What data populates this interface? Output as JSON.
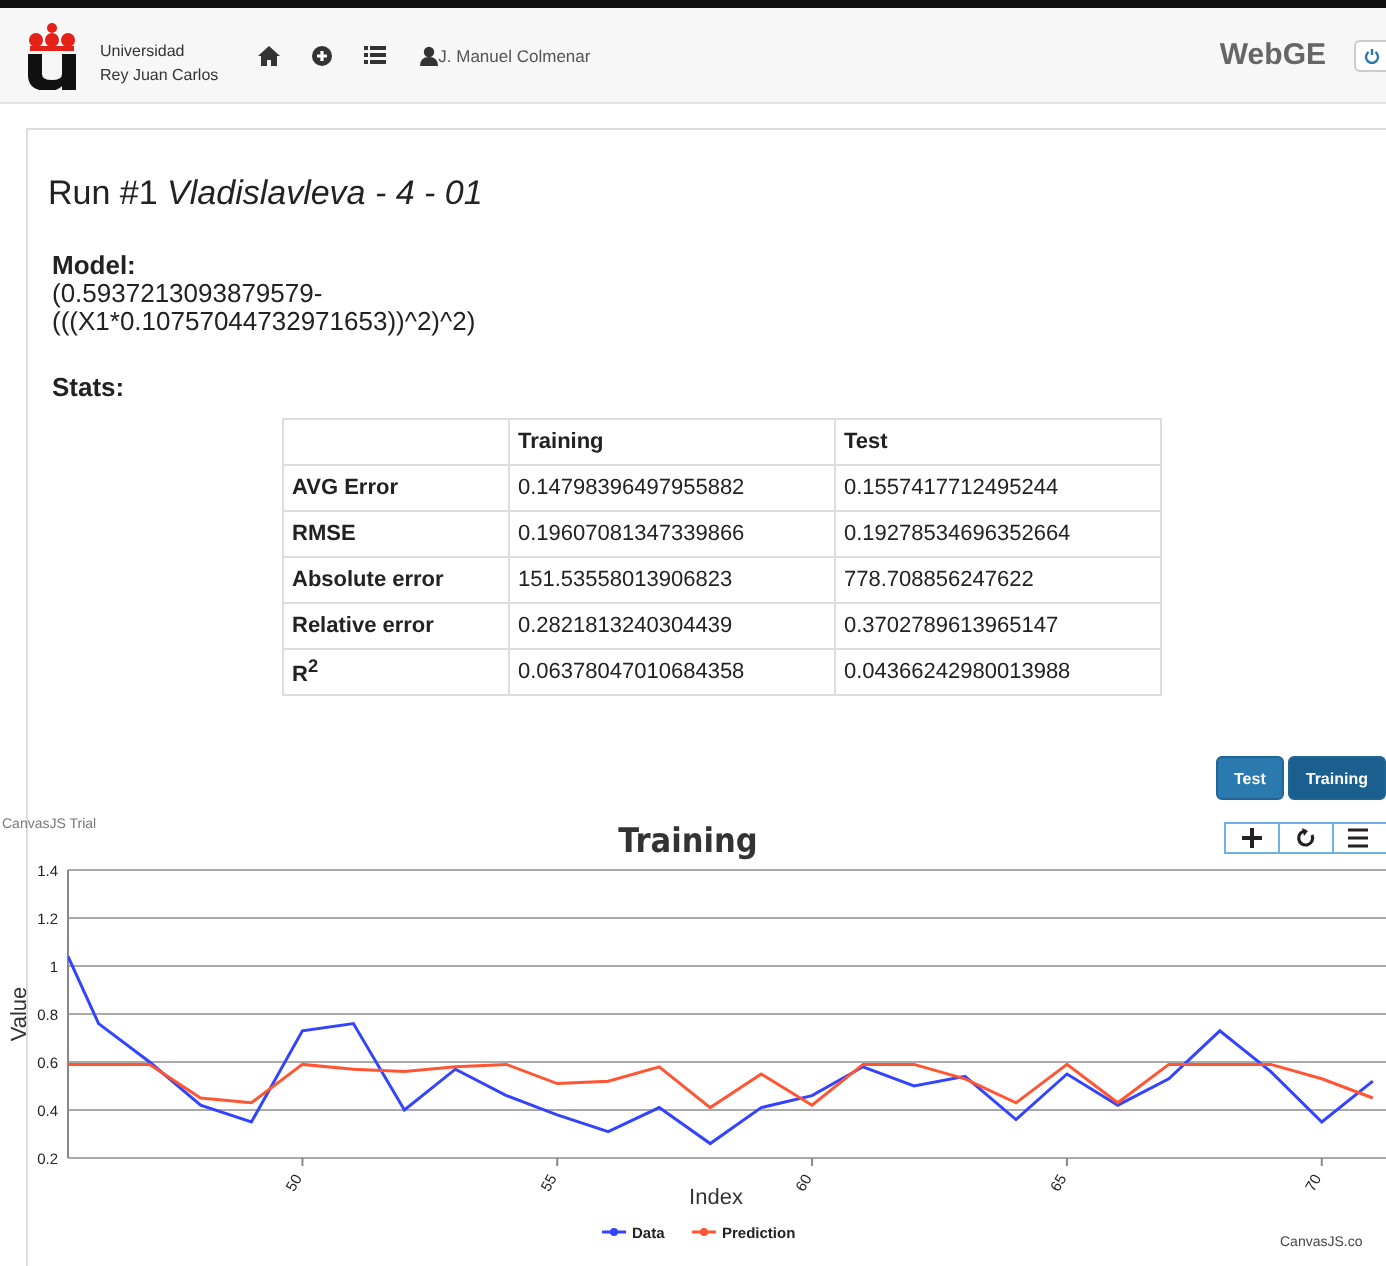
{
  "navbar": {
    "logo_text": [
      "Universidad",
      "Rey Juan Carlos"
    ],
    "user": "J. Manuel Colmenar",
    "app_name": "WebGE"
  },
  "run": {
    "title": "Run #1 *Vladislavleva - 4 - 01*",
    "model_label": "Model:",
    "model": "(0.5937213093879579-(((X1*0.10757044732971653))^2)^2)",
    "stats_label": "Stats:"
  },
  "stats_table": {
    "columns": [
      "",
      "Training",
      "Test"
    ],
    "rows": [
      [
        "AVG Error",
        "0.14798396497955882",
        "0.1557417712495244"
      ],
      [
        "RMSE",
        "0.19607081347339866",
        "0.19278534696352664"
      ],
      [
        "Absolute error",
        "151.53558013906823",
        "778.708856247622"
      ],
      [
        "Relative error",
        "0.2821813240304439",
        "0.3702789613965147"
      ],
      [
        "R$^{2}$",
        "0.06378047010684358",
        "0.04366242980013988"
      ]
    ]
  },
  "chart_tabs": [
    {
      "label": "Test",
      "selected": false
    },
    {
      "label": "Training",
      "selected": true
    }
  ],
  "chart": {
    "trial_text": "CanvasJS Trial",
    "credit": "CanvasJS.co",
    "chart_data": {
      "type": "line",
      "title": "Training",
      "xlabel": "Index",
      "ylabel": "Value",
      "x": [
        45.4,
        46,
        47,
        48,
        49,
        50,
        51,
        52,
        53,
        54,
        55,
        56,
        57,
        58,
        59,
        60,
        61,
        62,
        63,
        64,
        65,
        66,
        67,
        68,
        69,
        70,
        71
      ],
      "series": [
        {
          "name": "Data",
          "color": "#3344ff",
          "values": [
            1.04,
            0.76,
            0.6,
            0.42,
            0.35,
            0.73,
            0.76,
            0.4,
            0.57,
            0.46,
            0.38,
            0.31,
            0.41,
            0.26,
            0.41,
            0.46,
            0.58,
            0.5,
            0.54,
            0.36,
            0.55,
            0.42,
            0.53,
            0.73,
            0.56,
            0.35,
            0.52
          ]
        },
        {
          "name": "Prediction",
          "color": "#ff5533",
          "values": [
            0.59,
            0.59,
            0.59,
            0.45,
            0.43,
            0.59,
            0.57,
            0.56,
            0.58,
            0.59,
            0.51,
            0.52,
            0.58,
            0.41,
            0.55,
            0.42,
            0.59,
            0.59,
            0.53,
            0.43,
            0.59,
            0.43,
            0.59,
            0.59,
            0.59,
            0.53,
            0.45
          ]
        }
      ],
      "xlim": [
        45.4,
        71.3
      ],
      "ylim": [
        0.2,
        1.4
      ],
      "xticks": [
        50,
        55,
        60,
        65,
        70
      ],
      "yticks": [
        0.2,
        0.4,
        0.6,
        0.8,
        1,
        1.2,
        1.4
      ],
      "grid": true,
      "legend": "bottom"
    }
  }
}
